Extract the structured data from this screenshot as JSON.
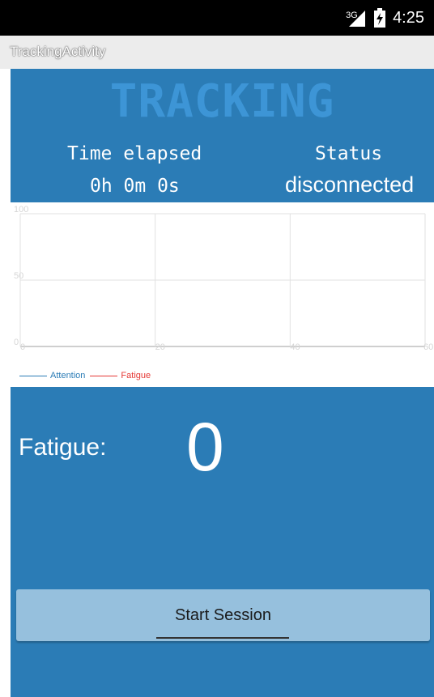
{
  "status_bar": {
    "network": "3G",
    "time": "4:25",
    "icons": [
      "signal-icon",
      "battery-icon"
    ]
  },
  "app_bar": {
    "title": "TrackingActivity"
  },
  "header": {
    "title": "TRACKING",
    "time_label": "Time elapsed",
    "time_value": "0h 0m 0s",
    "status_label": "Status",
    "status_value": "disconnected"
  },
  "chart_data": {
    "type": "line",
    "x": [],
    "series": [
      {
        "name": "Attention",
        "values": []
      },
      {
        "name": "Fatigue",
        "values": []
      }
    ],
    "xlim": [
      0,
      60
    ],
    "ylim": [
      0,
      100
    ],
    "x_ticks": [
      "0",
      "20",
      "40",
      "60"
    ],
    "y_ticks": [
      "0",
      "50",
      "100"
    ],
    "grid": true,
    "legend": "bottom-left",
    "series_colors": [
      "#2b7cb6",
      "#e53935"
    ]
  },
  "fatigue": {
    "label": "Fatigue:",
    "value": "0"
  },
  "controls": {
    "start_label": "Start Session"
  },
  "colors": {
    "panel": "#2b7cb6",
    "title_accent": "#3d95d6",
    "button": "#96c0dd"
  }
}
